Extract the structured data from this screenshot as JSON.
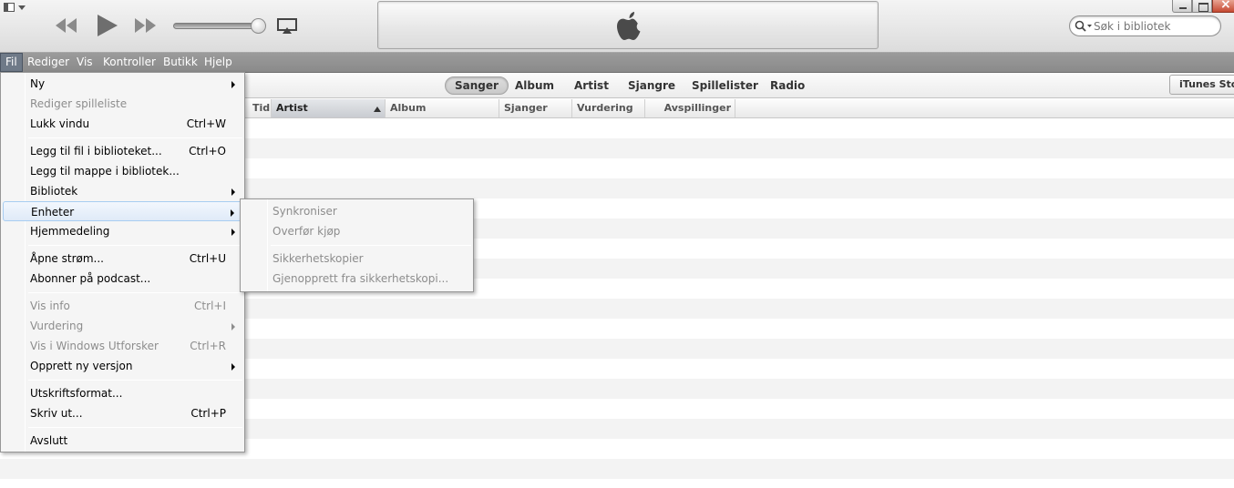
{
  "menubar": {
    "items": [
      "Fil",
      "Rediger",
      "Vis",
      "Kontroller",
      "Butikk",
      "Hjelp"
    ]
  },
  "search": {
    "placeholder": "Søk i bibliotek"
  },
  "tabs": [
    "Sanger",
    "Album",
    "Artist",
    "Sjangre",
    "Spillelister",
    "Radio"
  ],
  "store_button": "iTunes Store",
  "columns": [
    "Tid",
    "Artist",
    "Album",
    "Sjanger",
    "Vurdering",
    "Avspillinger"
  ],
  "file_menu": {
    "items": [
      {
        "label": "Ny",
        "shortcut": ""
      },
      {
        "label": "Rediger spilleliste",
        "shortcut": ""
      },
      {
        "label": "Lukk vindu",
        "shortcut": "Ctrl+W"
      },
      {
        "label": "Legg til fil i biblioteket...",
        "shortcut": "Ctrl+O"
      },
      {
        "label": "Legg til mappe i bibliotek...",
        "shortcut": ""
      },
      {
        "label": "Bibliotek",
        "shortcut": ""
      },
      {
        "label": "Enheter",
        "shortcut": ""
      },
      {
        "label": "Hjemmedeling",
        "shortcut": ""
      },
      {
        "label": "Åpne strøm...",
        "shortcut": "Ctrl+U"
      },
      {
        "label": "Abonner på podcast...",
        "shortcut": ""
      },
      {
        "label": "Vis info",
        "shortcut": "Ctrl+I"
      },
      {
        "label": "Vurdering",
        "shortcut": ""
      },
      {
        "label": "Vis i Windows Utforsker",
        "shortcut": "Ctrl+R"
      },
      {
        "label": "Opprett ny versjon",
        "shortcut": ""
      },
      {
        "label": "Utskriftsformat...",
        "shortcut": ""
      },
      {
        "label": "Skriv ut...",
        "shortcut": "Ctrl+P"
      },
      {
        "label": "Avslutt",
        "shortcut": ""
      }
    ]
  },
  "units_submenu": {
    "items": [
      {
        "label": "Synkroniser"
      },
      {
        "label": "Overfør kjøp"
      },
      {
        "label": "Sikkerhetskopier"
      },
      {
        "label": "Gjenopprett fra sikkerhetskopi..."
      }
    ]
  }
}
